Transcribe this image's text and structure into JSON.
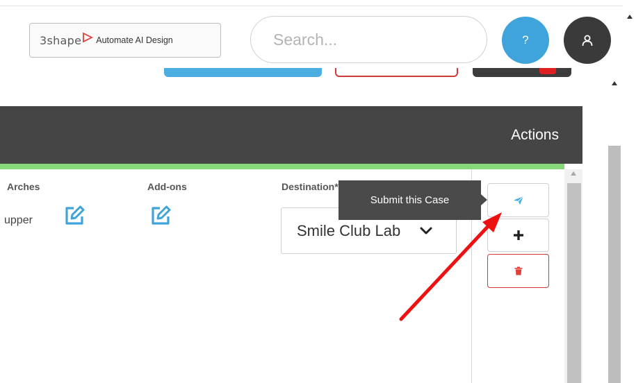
{
  "header": {
    "brand_word": "3shape",
    "brand_tag": "Automate AI Design",
    "search_placeholder": "Search...",
    "help_label": "?"
  },
  "table": {
    "actions_header": "Actions",
    "columns": {
      "arches": "Arches",
      "addons": "Add-ons",
      "destination": "Destination*"
    },
    "row": {
      "arches_value": "upper",
      "destination_value": "Smile Club Lab"
    }
  },
  "tooltip": {
    "text": "Submit this Case"
  },
  "colors": {
    "header_bg": "#454545",
    "accent_blue": "#3fa4dc",
    "status_green": "#86d97b",
    "danger_red": "#d23a3a",
    "annotation_arrow": "#ee1111"
  },
  "icons": {
    "search": "search-icon",
    "user": "user-icon",
    "edit": "edit-icon",
    "submit": "paper-plane-icon",
    "add": "plus-icon",
    "delete": "trash-icon",
    "dropdown": "chevron-down-icon"
  }
}
